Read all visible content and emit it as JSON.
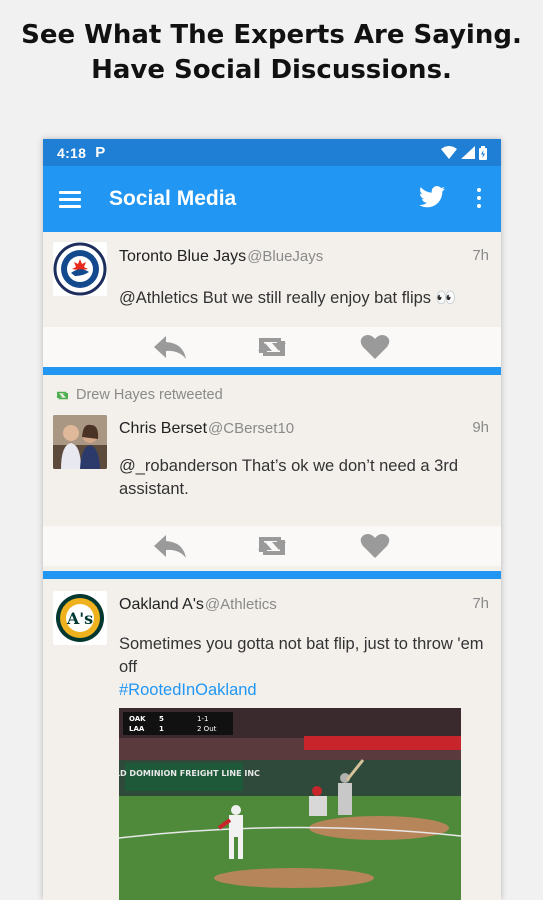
{
  "promo": {
    "line1": "See What The Experts Are Saying.",
    "line2": "Have Social Discussions."
  },
  "status_bar": {
    "time": "4:18",
    "app_icon": "P"
  },
  "app_bar": {
    "title": "Social Media",
    "icons": [
      "menu-icon",
      "twitter-bird-icon",
      "more-vert-icon"
    ]
  },
  "colors": {
    "primary": "#2196f3",
    "status_bar": "#1f7fd4",
    "hashtag": "#2196f3",
    "retweet_green": "#4caf50"
  },
  "tweets": [
    {
      "author": "Toronto Blue Jays",
      "handle": "@BlueJays",
      "time": "7h",
      "text": "@Athletics But we still really enjoy bat flips 👀"
    },
    {
      "retweeted_by": "Drew Hayes retweeted",
      "author": "Chris Berset",
      "handle": "@CBerset10",
      "time": "9h",
      "text": "@_robanderson That’s ok we don’t need a 3rd assistant."
    },
    {
      "author": "Oakland A's",
      "handle": "@Athletics",
      "time": "7h",
      "text": "Sometimes you gotta not bat flip, just to throw 'em off",
      "hashtag": "#RootedInOakland",
      "media": {
        "scoreboard_oak": "OAK",
        "scoreboard_laa": "LAA",
        "oak_runs": "5",
        "laa_runs": "1",
        "count": "1-1",
        "outs": "2 Out",
        "banner": "OLD DOMINION FREIGHT LINE INC"
      }
    }
  ]
}
